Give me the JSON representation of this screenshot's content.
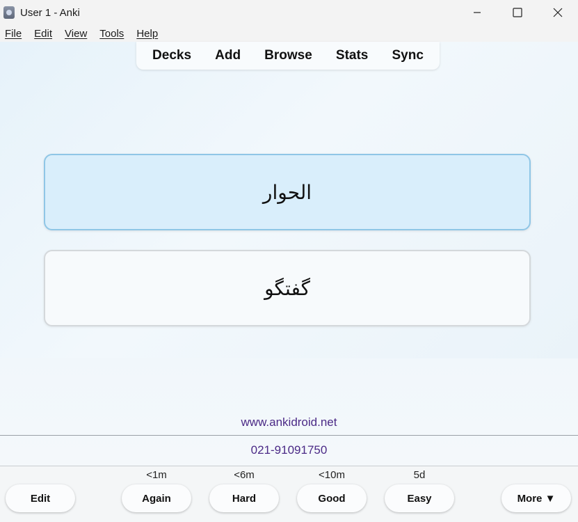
{
  "window": {
    "title": "User 1 - Anki",
    "app_icon": "anki-icon"
  },
  "menubar": {
    "items": [
      "File",
      "Edit",
      "View",
      "Tools",
      "Help"
    ]
  },
  "toolbar": {
    "items": [
      "Decks",
      "Add",
      "Browse",
      "Stats",
      "Sync"
    ]
  },
  "cards": [
    {
      "text": "الحوار",
      "state": "selected"
    },
    {
      "text": "گفتگو",
      "state": "normal"
    }
  ],
  "footer": {
    "website": "www.ankidroid.net",
    "phone": "021-91091750"
  },
  "answer_bar": {
    "edit_label": "Edit",
    "buttons": [
      {
        "label": "Again",
        "interval": "<1m"
      },
      {
        "label": "Hard",
        "interval": "<6m"
      },
      {
        "label": "Good",
        "interval": "<10m"
      },
      {
        "label": "Easy",
        "interval": "5d"
      }
    ],
    "more_label": "More ▼"
  },
  "colors": {
    "accent_link": "#4b2a86",
    "selected_card_bg": "#d9eefb",
    "selected_card_border": "#8fc6e6"
  }
}
